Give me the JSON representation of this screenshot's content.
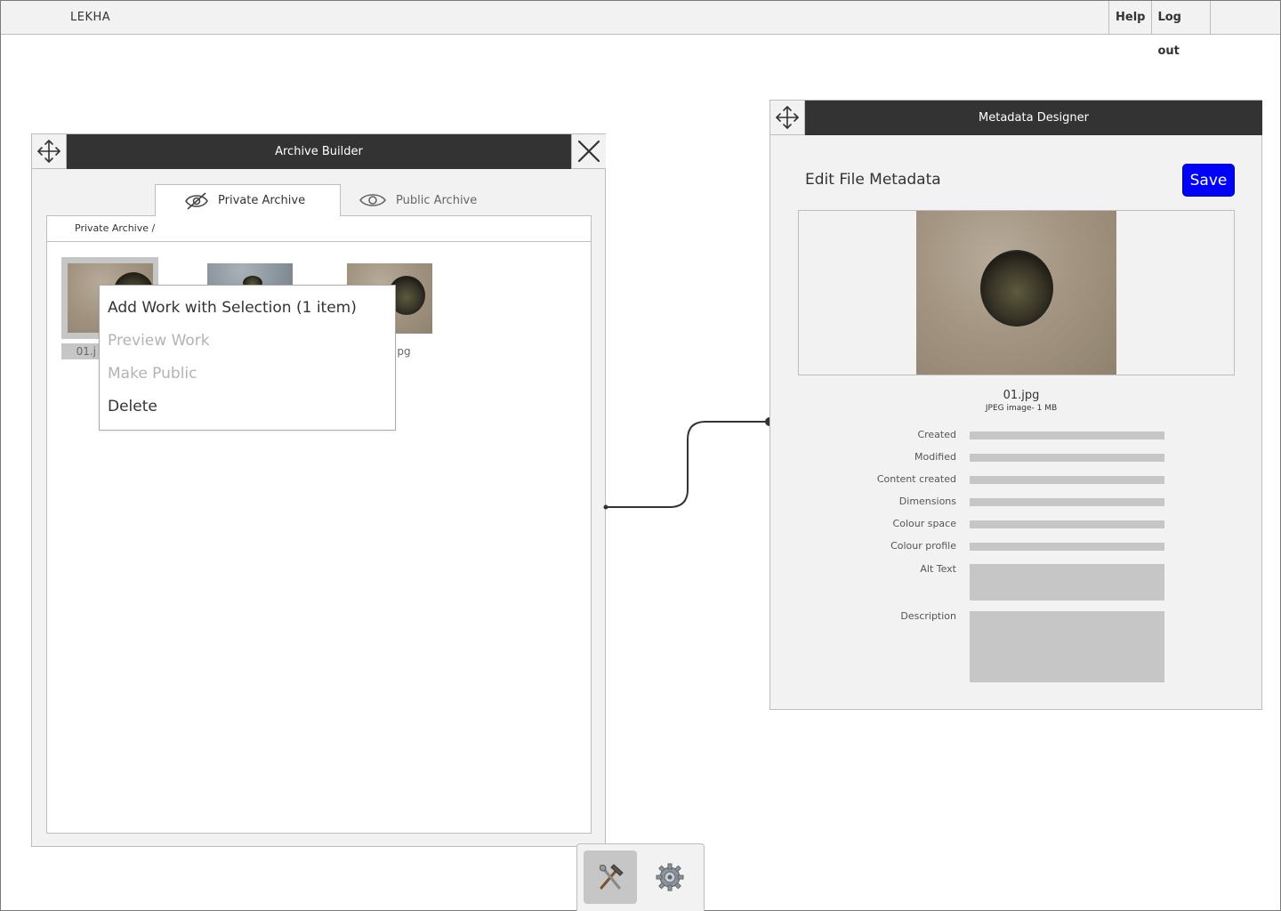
{
  "app": {
    "name": "LEKHA"
  },
  "topnav": {
    "help": "Help",
    "logout": "Log out"
  },
  "archive_builder": {
    "title": "Archive Builder",
    "tabs": [
      {
        "label": "Private Archive",
        "icon": "eye-slash-icon",
        "active": true
      },
      {
        "label": "Public Archive",
        "icon": "eye-icon",
        "active": false
      }
    ],
    "breadcrumb": "Private Archive /",
    "files": [
      {
        "label": "01.j",
        "selected": true
      },
      {
        "label": "",
        "selected": false
      },
      {
        "label": "pg",
        "selected": false
      }
    ]
  },
  "context_menu": {
    "items": [
      {
        "label": "Add Work with Selection (1 item)",
        "enabled": true
      },
      {
        "label": "Preview Work",
        "enabled": false
      },
      {
        "label": "Make Public",
        "enabled": false
      },
      {
        "label": "Delete",
        "enabled": true
      }
    ]
  },
  "metadata_designer": {
    "title": "Metadata Designer",
    "heading": "Edit File Metadata",
    "save_label": "Save",
    "file_name": "01.jpg",
    "file_info": "JPEG image- 1 MB",
    "fields": [
      {
        "label": "Created"
      },
      {
        "label": "Modified"
      },
      {
        "label": "Content created"
      },
      {
        "label": "Dimensions"
      },
      {
        "label": "Colour space"
      },
      {
        "label": "Colour profile"
      },
      {
        "label": "Alt Text"
      },
      {
        "label": "Description"
      }
    ]
  },
  "dock": {
    "items": [
      {
        "icon": "hammer-wrench-icon",
        "active": true
      },
      {
        "icon": "gear-icon",
        "active": false
      }
    ]
  },
  "colors": {
    "header": "#333333",
    "panel": "#f2f2f2",
    "accent": "#0000ff",
    "placeholder": "#c6c6c6"
  }
}
